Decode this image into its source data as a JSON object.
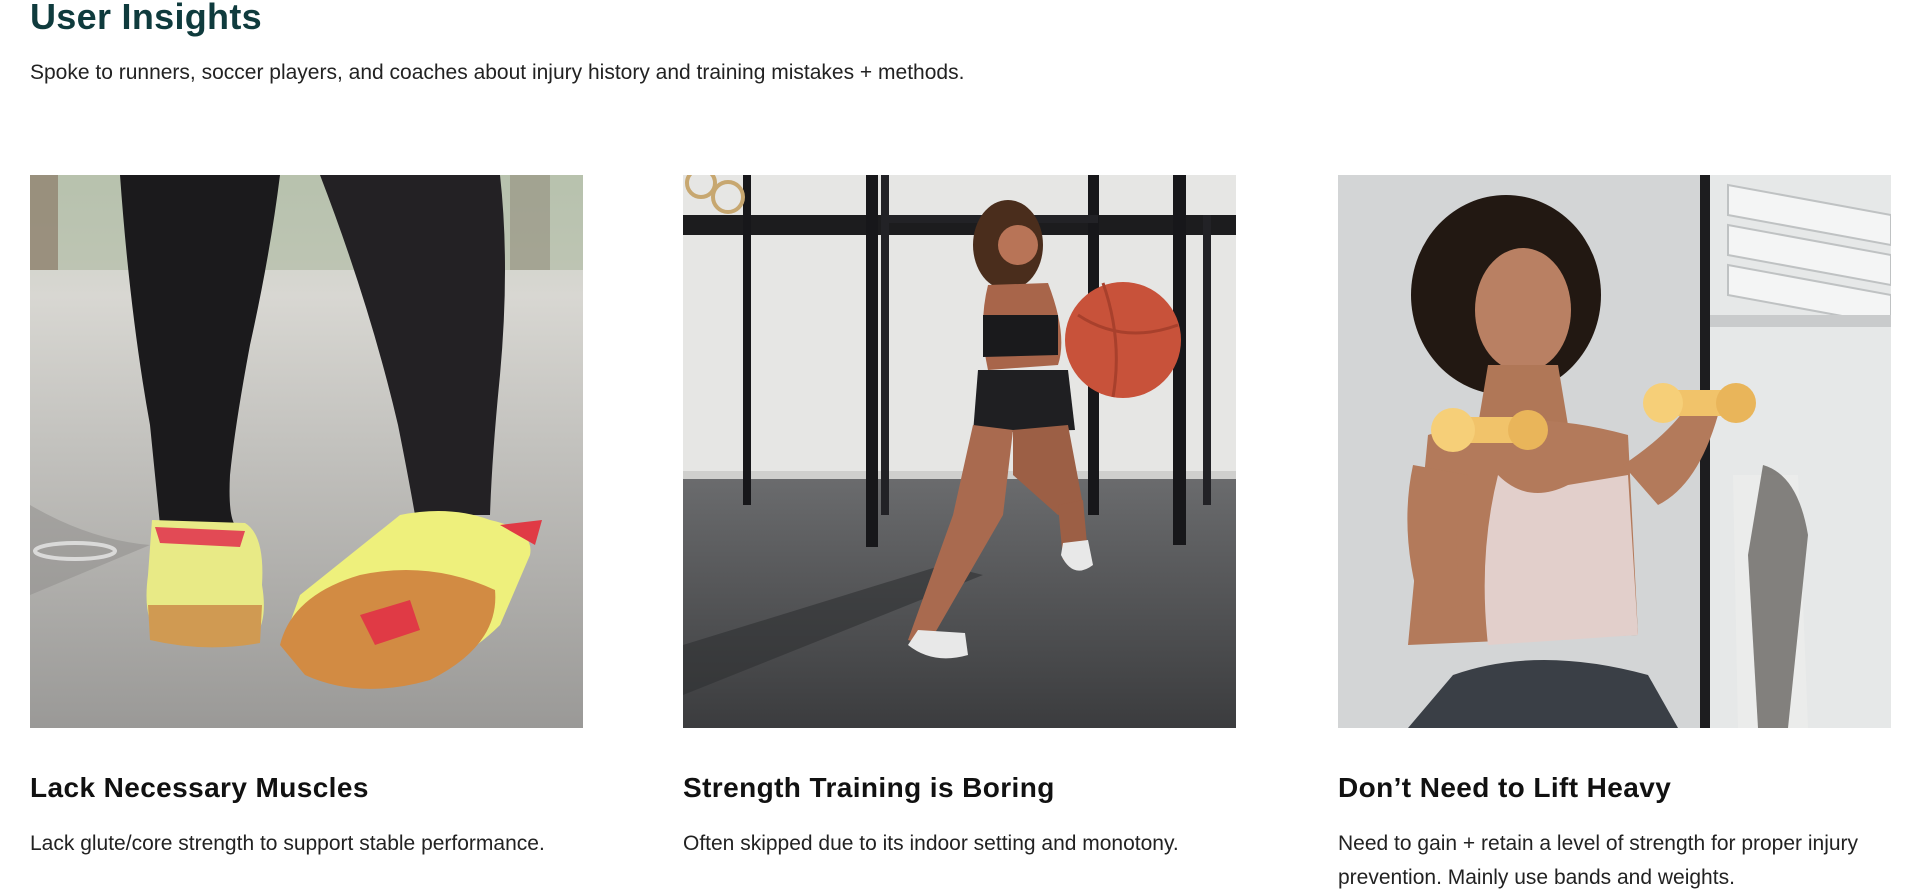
{
  "header": {
    "title": "User Insights",
    "subtitle": "Spoke to runners, soccer players, and coaches about injury history and training mistakes + methods."
  },
  "cards": [
    {
      "image": "photo-legs-sneakers",
      "title": "Lack Necessary Muscles",
      "text": "Lack glute/core strength to support stable performance."
    },
    {
      "image": "photo-woman-lunge-medicine-ball",
      "title": "Strength Training is Boring",
      "text": "Often skipped due to its indoor setting and monotony."
    },
    {
      "image": "photo-woman-dumbbells",
      "title": "Don’t Need to Lift Heavy",
      "text": "Need to gain + retain a level of strength for proper injury prevention. Mainly use bands and weights."
    }
  ],
  "colors": {
    "heading": "#0f3b3d",
    "text": "#222222",
    "background": "#ffffff"
  }
}
